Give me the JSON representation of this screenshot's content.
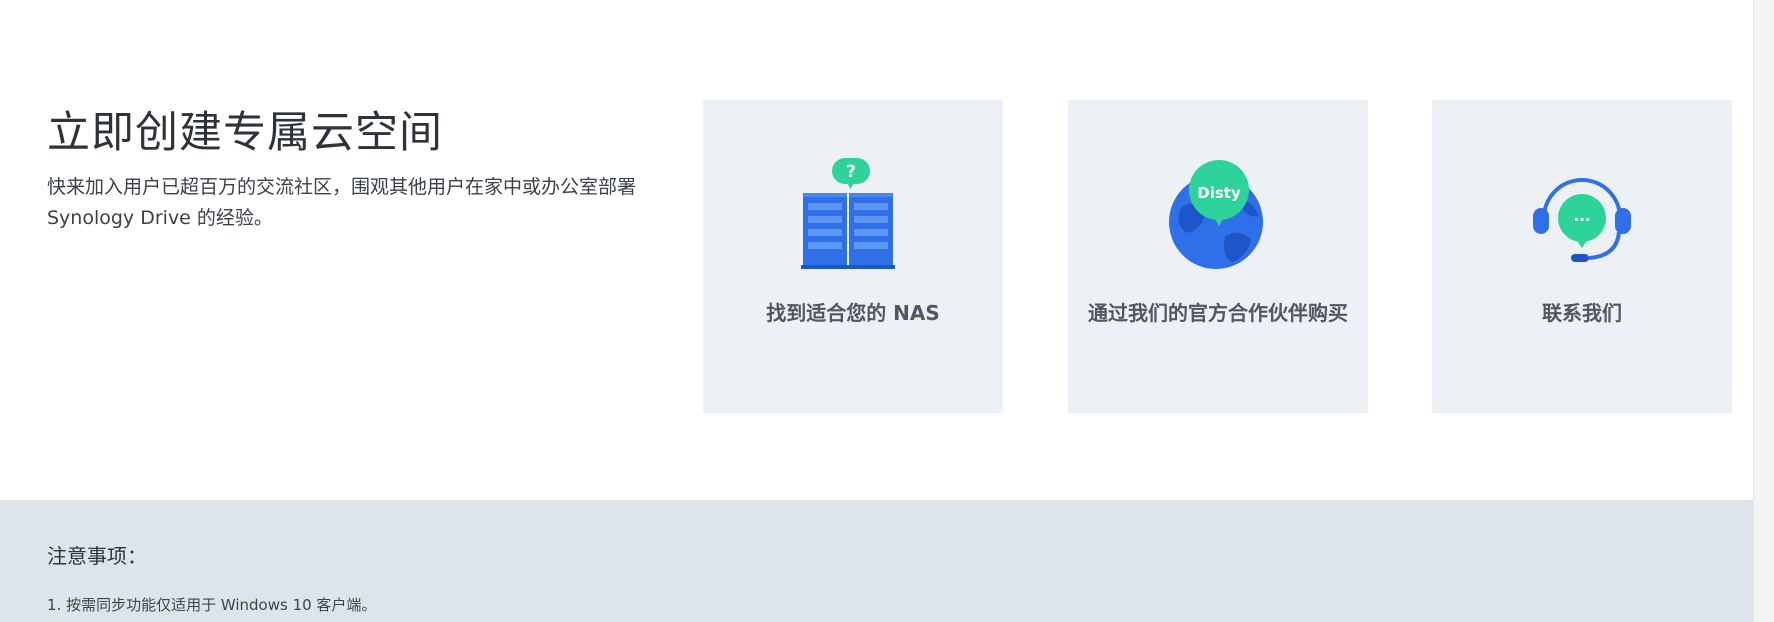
{
  "hero": {
    "title": "立即创建专属云空间",
    "description": "快来加入用户已超百万的交流社区，围观其他用户在家中或办公室部署 Synology Drive 的经验。"
  },
  "cards": [
    {
      "label": "找到适合您的 NAS",
      "icon": "nas-question-icon",
      "bubble_text": "?"
    },
    {
      "label": "通过我们的官方合作伙伴购买",
      "icon": "globe-disty-icon",
      "bubble_text": "Disty"
    },
    {
      "label": "联系我们",
      "icon": "headset-chat-icon",
      "bubble_text": "..."
    }
  ],
  "notes": {
    "title": "注意事项：",
    "items": [
      "1. 按需同步功能仅适用于 Windows 10 客户端。"
    ]
  },
  "colors": {
    "icon_blue": "#2f6fe8",
    "icon_green": "#2ed39a",
    "card_bg": "#edf0f5",
    "notes_bg": "#dde4ec"
  }
}
